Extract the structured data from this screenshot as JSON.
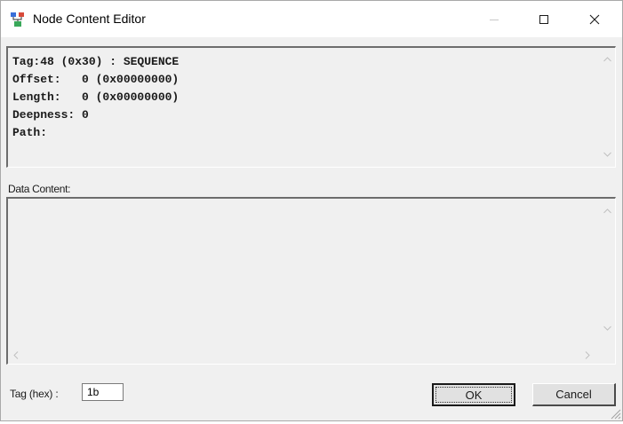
{
  "window": {
    "title": "Node Content Editor",
    "icon": "tree-nodes-icon",
    "controls": {
      "minimize": "minimize-icon",
      "maximize": "maximize-icon",
      "close": "close-icon"
    }
  },
  "node_info": {
    "text": "Tag:48 (0x30) : SEQUENCE\nOffset:   0 (0x00000000)\nLength:   0 (0x00000000)\nDeepness: 0\nPath:"
  },
  "data_content": {
    "label": "Data Content:",
    "value": ""
  },
  "tag_hex": {
    "label": "Tag (hex) :",
    "value": "1b"
  },
  "buttons": {
    "ok": "OK",
    "cancel": "Cancel"
  },
  "colors": {
    "window_bg": "#f0f0f0",
    "titlebar_bg": "#ffffff",
    "text": "#1a1a1a"
  }
}
